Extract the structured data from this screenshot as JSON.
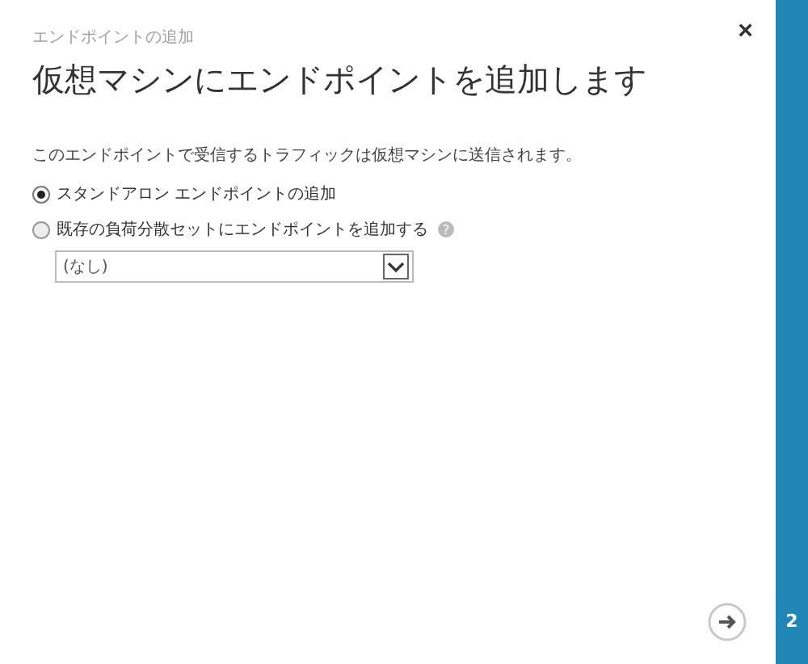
{
  "dialog": {
    "subtitle": "エンドポイントの追加",
    "title": "仮想マシンにエンドポイントを追加します",
    "close": "×"
  },
  "description": "このエンドポイントで受信するトラフィックは仮想マシンに送信されます。",
  "options": [
    {
      "label": "スタンドアロン エンドポイントの追加",
      "selected": true
    },
    {
      "label": "既存の負荷分散セットにエンドポイントを追加する",
      "selected": false,
      "help": "?"
    }
  ],
  "dropdown": {
    "value": "(なし)"
  },
  "step": "2"
}
